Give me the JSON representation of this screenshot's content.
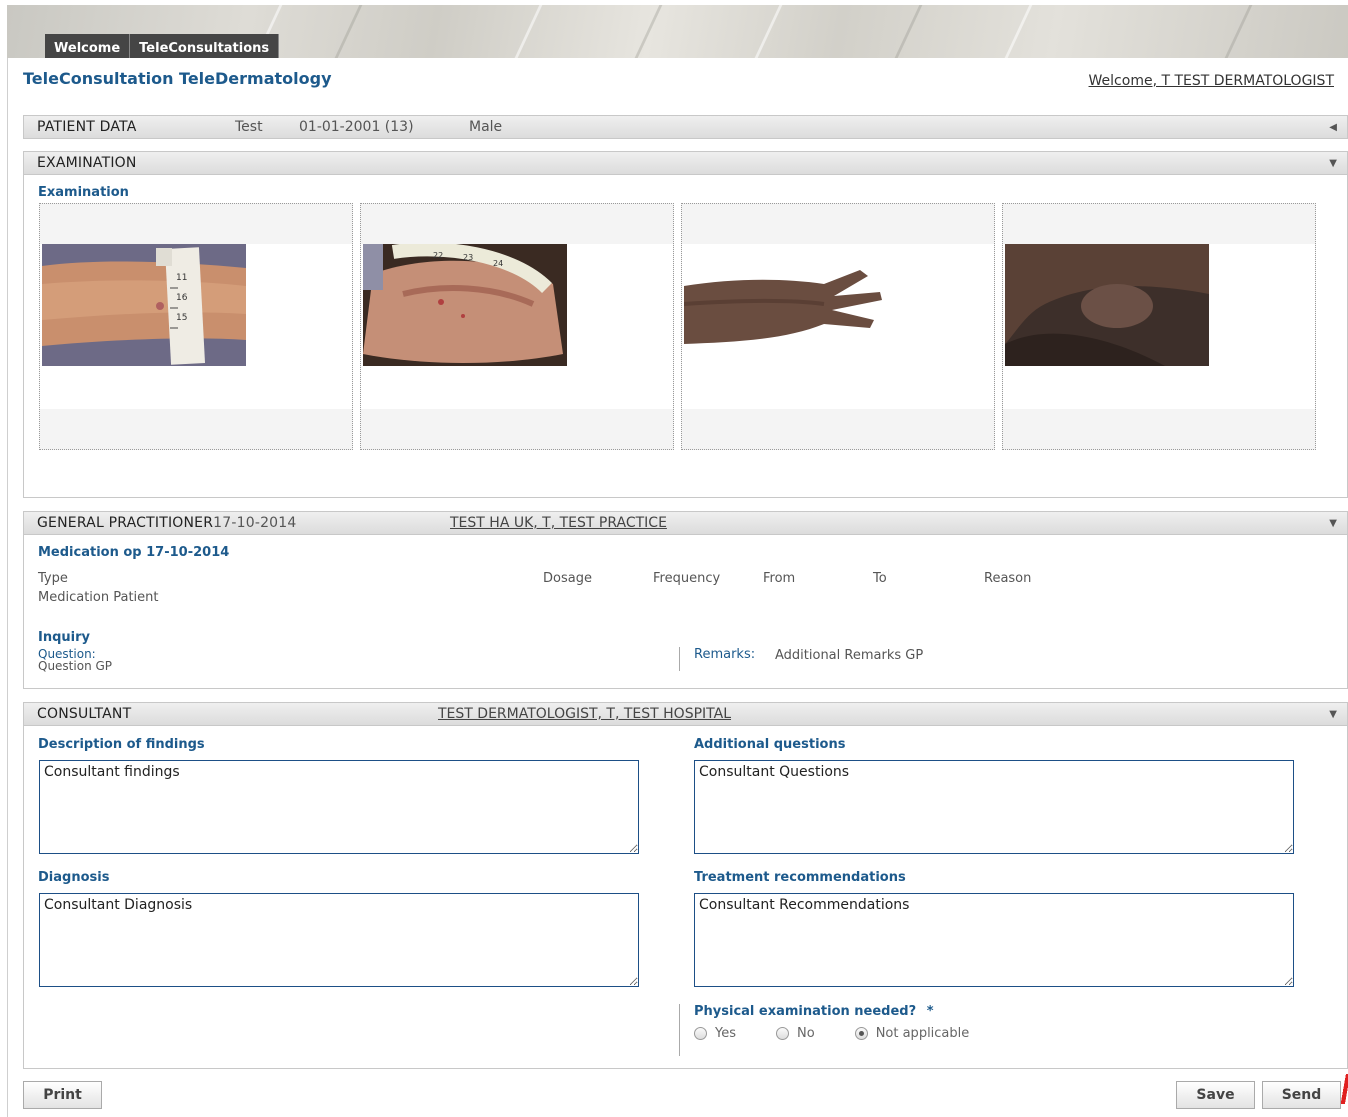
{
  "tabs": [
    "Welcome",
    "TeleConsultations"
  ],
  "app_title": "TeleConsultation TeleDermatology",
  "welcome_user": "Welcome, T TEST DERMATOLOGIST",
  "patient": {
    "section": "PATIENT DATA",
    "name": "Test",
    "dob": "01-01-2001 (13)",
    "sex": "Male"
  },
  "examination": {
    "section": "EXAMINATION",
    "subtitle": "Examination",
    "images": [
      "wrist-measuring-tape-photo",
      "hand-measuring-tape-photo",
      "hand-back-photo",
      "wrist-skin-photo"
    ]
  },
  "gp": {
    "section": "GENERAL PRACTITIONER",
    "date": "17-10-2014",
    "practitioner": "TEST HA UK, T, TEST PRACTICE",
    "medication_title": "Medication op 17-10-2014",
    "columns": [
      "Type",
      "Dosage",
      "Frequency",
      "From",
      "To",
      "Reason"
    ],
    "medication_row": "Medication Patient",
    "inquiry_title": "Inquiry",
    "question_label": "Question:",
    "question_value": "Question GP",
    "remarks_label": "Remarks:",
    "remarks_value": "Additional Remarks GP"
  },
  "consultant": {
    "section": "CONSULTANT",
    "name": "TEST DERMATOLOGIST, T, TEST HOSPITAL",
    "findings_label": "Description of findings",
    "findings_value": "Consultant findings",
    "questions_label": "Additional questions",
    "questions_value": "Consultant Questions",
    "diagnosis_label": "Diagnosis",
    "diagnosis_value": "Consultant Diagnosis",
    "treatment_label": "Treatment recommendations",
    "treatment_value": "Consultant Recommendations",
    "physical_label": "Physical examination needed?",
    "required_mark": "*",
    "options": [
      "Yes",
      "No",
      "Not applicable"
    ],
    "selected_option": "Not applicable"
  },
  "buttons": {
    "print": "Print",
    "save": "Save",
    "send": "Send"
  }
}
